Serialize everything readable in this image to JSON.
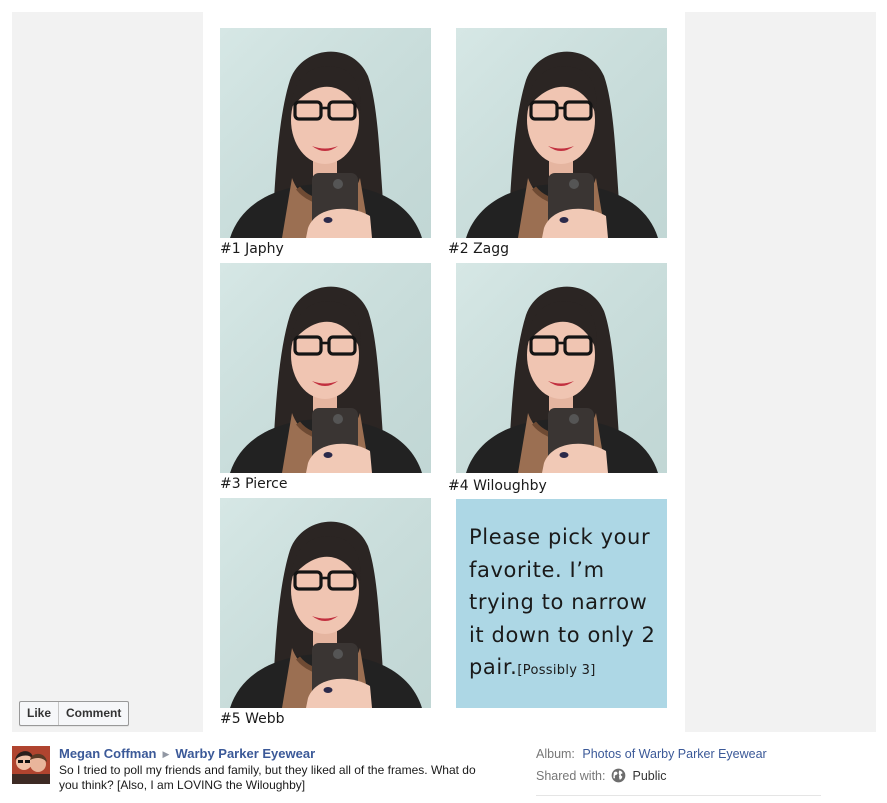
{
  "photo": {
    "captions": [
      "#1 Japhy",
      "#2 Zagg",
      "#3 Pierce",
      "#4 Wiloughby",
      "#5 Webb"
    ],
    "note": {
      "main": "Please pick your favorite. I’m trying to narrow it down to only 2 pair.",
      "small": "[Possibly 3]"
    }
  },
  "actions": {
    "like_label": "Like",
    "comment_label": "Comment"
  },
  "post": {
    "author": "Megan Coffman",
    "target": "Warby Parker Eyewear",
    "text": "So I tried to poll my friends and family, but they liked all of the frames. What do you think? [Also, I am LOVING the Wiloughby]"
  },
  "meta": {
    "album_label": "Album:",
    "album_value": "Photos of Warby Parker Eyewear",
    "shared_label": "Shared with:",
    "shared_value": "Public",
    "shared_icon": "globe-icon"
  },
  "colors": {
    "link": "#3b5998",
    "note_card": "#add7e5",
    "viewer_background": "#f2f2f2"
  }
}
